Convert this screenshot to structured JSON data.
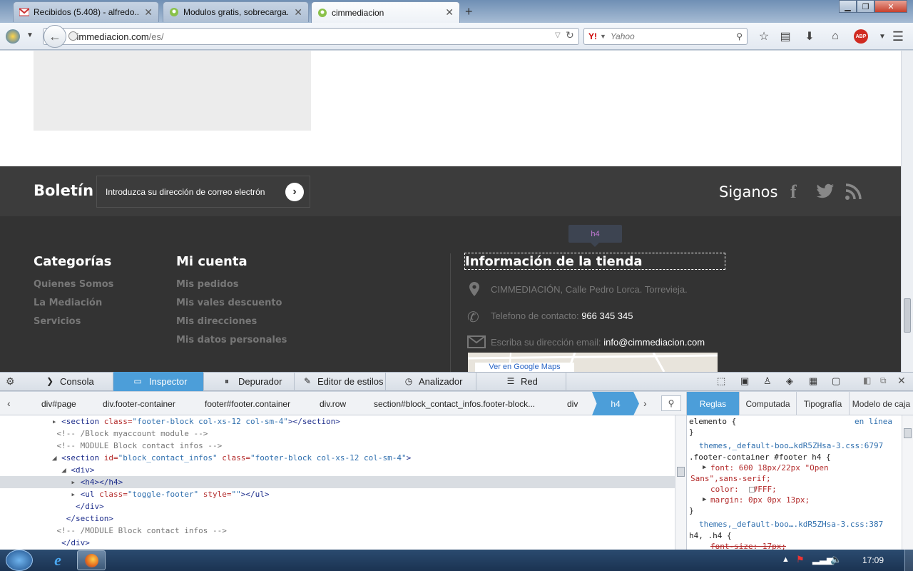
{
  "tabs": [
    {
      "label": "Recibidos (5.408) - alfredo...",
      "icon": "gmail-icon"
    },
    {
      "label": "Modulos gratis, sobrecarga...",
      "icon": "prestashop-icon"
    },
    {
      "label": "cimmediacion",
      "icon": "prestashop-icon"
    }
  ],
  "url": {
    "host": "cimmediacion.com",
    "path": "/es/"
  },
  "search": {
    "engine": "Y!",
    "placeholder": "Yahoo"
  },
  "newsletter": {
    "title": "Boletín",
    "placeholder": "Introduzca su dirección de correo electrón",
    "follow": "Siganos"
  },
  "footer": {
    "tooltip": "h4",
    "categorias": {
      "title": "Categorías",
      "items": [
        "Quienes Somos",
        "La Mediación",
        "Servicios"
      ]
    },
    "cuenta": {
      "title": "Mi cuenta",
      "items": [
        "Mis pedidos",
        "Mis vales descuento",
        "Mis direcciones",
        "Mis datos personales"
      ]
    },
    "info": {
      "title": "Información de la tienda",
      "address": "CIMMEDIACIÓN, Calle Pedro Lorca. Torrevieja.",
      "phone_label": "Telefono de contacto: ",
      "phone": "966 345 345",
      "email_label": "Escriba su dirección email: ",
      "email": "info@cimmediacion.com",
      "maps_link": "Ver en Google Maps"
    }
  },
  "devtools": {
    "tabs": [
      "Consola",
      "Inspector",
      "Depurador",
      "Editor de estilos",
      "Analizador",
      "Red"
    ],
    "selected_tab": "Inspector",
    "breadcrumbs": [
      "div#page",
      "div.footer-container",
      "footer#footer.container",
      "div.row",
      "section#block_contact_infos.footer-block...",
      "div",
      "h4"
    ],
    "rule_tabs": [
      "Reglas",
      "Computada",
      "Tipografía",
      "Modelo de caja"
    ],
    "markup": [
      {
        "pre": "  ",
        "open": "▸",
        "t1": "<section ",
        "a1": "class=",
        "v1": "\"footer-block col-xs-12 col-sm-4\"",
        "t2": "></section>"
      },
      {
        "pre": "   ",
        "cm": "<!-- /Block myaccount module -->"
      },
      {
        "pre": "   ",
        "cm": "<!-- MODULE Block contact infos -->"
      },
      {
        "pre": "  ",
        "open": "◢",
        "t1": "<section ",
        "a1": "id=",
        "v1": "\"block_contact_infos\"",
        "a2": " class=",
        "v2": "\"footer-block col-xs-12 col-sm-4\"",
        "t2": ">"
      },
      {
        "pre": "    ",
        "open": "◢",
        "t1": "<div>"
      },
      {
        "pre": "      ",
        "open": "▸",
        "t1": "<h4></h4>"
      },
      {
        "pre": "      ",
        "open": "▸",
        "t1": "<ul ",
        "a1": "class=",
        "v1": "\"toggle-footer\"",
        "a2": " style=",
        "v2": "\"\"",
        "t2": "></ul>"
      },
      {
        "pre": "       ",
        "t1": "</div>"
      },
      {
        "pre": "     ",
        "t1": "</section>"
      },
      {
        "pre": "   ",
        "cm": "<!-- /MODULE Block contact infos -->"
      },
      {
        "pre": "    ",
        "t1": "</div>"
      }
    ],
    "rules": {
      "element": "elemento {",
      "inline": "en línea",
      "close": "}",
      "src1": "themes,_default-boo…kdR5ZHsa-3.css:6797",
      "sel1": ".footer-container #footer h4 {",
      "p1": "font: 600 18px/22px \"Open",
      "p1b": "Sans\",sans-serif;",
      "p2": "color:   #FFF;",
      "p3": "margin: 0px 0px 13px;",
      "src2": "themes,_default-boo….kdR5ZHsa-3.css:387",
      "sel2": "h4, .h4 {",
      "p4": "font-size: 17px;"
    }
  },
  "clock": "17:09"
}
